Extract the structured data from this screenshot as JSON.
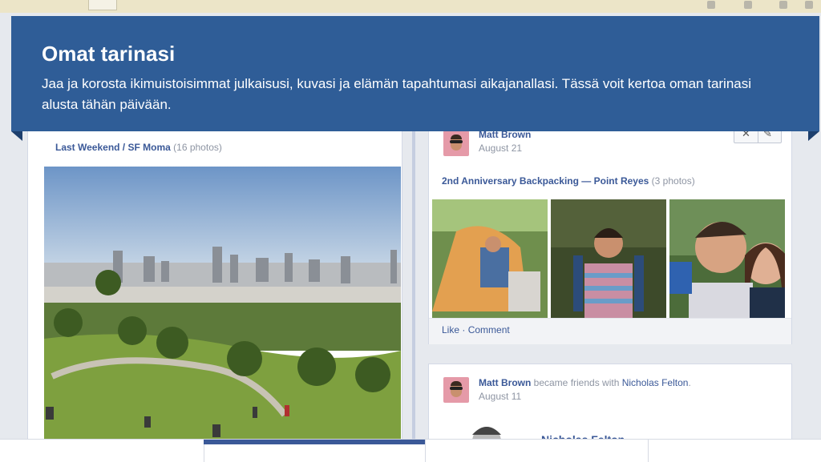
{
  "banner": {
    "title": "Omat tarinasi",
    "body": "Jaa ja korosta ikimuistoisimmat julkaisusi, kuvasi ja elämän tapahtumasi aikajanallasi. Tässä voit kertoa oman tarinasi alusta tähän päivään.",
    "color": "#2f5d97"
  },
  "left_post": {
    "album_link": "Last Weekend / SF Moma",
    "photo_count": "(16 photos)"
  },
  "right_post_1": {
    "author": "Matt Brown",
    "date": "August 21",
    "album_link": "2nd Anniversary Backpacking — Point Reyes",
    "photo_count": "(3 photos)",
    "like": "Like",
    "separator": " · ",
    "comment": "Comment",
    "close_icon": "close-icon",
    "edit_icon": "pencil-icon"
  },
  "right_post_2": {
    "author": "Matt Brown",
    "verb": " became friends with ",
    "friend": "Nicholas Felton",
    "period": ".",
    "date": "August 11",
    "friend_card_name": "Nicholas Felton"
  },
  "colors": {
    "link": "#3b5998",
    "meta": "#8e95a3",
    "background": "#e6e9ee"
  }
}
